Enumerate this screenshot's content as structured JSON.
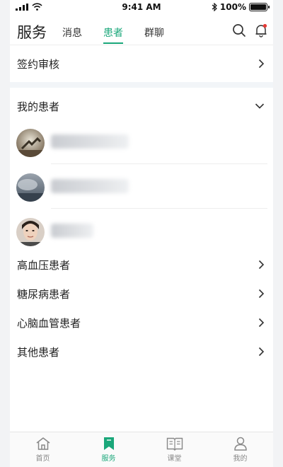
{
  "status_bar": {
    "time": "9:41 AM",
    "battery": "100%"
  },
  "header": {
    "title": "服务",
    "tabs": [
      {
        "label": "消息",
        "active": false
      },
      {
        "label": "患者",
        "active": true
      },
      {
        "label": "群聊",
        "active": false
      }
    ]
  },
  "sections": {
    "sign_review": "签约审核",
    "my_patients": "我的患者"
  },
  "patient_groups": [
    {
      "label": "高血压患者"
    },
    {
      "label": "糖尿病患者"
    },
    {
      "label": "心脑血管患者"
    },
    {
      "label": "其他患者"
    }
  ],
  "bottom_nav": [
    {
      "label": "首页",
      "icon": "home-icon",
      "active": false
    },
    {
      "label": "服务",
      "icon": "bookmark-icon",
      "active": true
    },
    {
      "label": "课堂",
      "icon": "book-icon",
      "active": false
    },
    {
      "label": "我的",
      "icon": "user-icon",
      "active": false
    }
  ],
  "colors": {
    "accent": "#1aa77a",
    "notification_dot": "#e53935"
  }
}
